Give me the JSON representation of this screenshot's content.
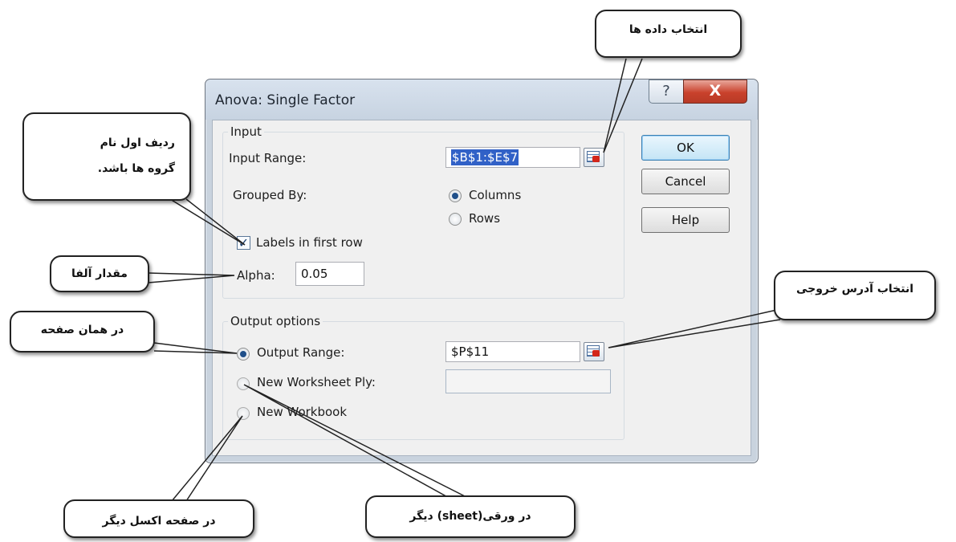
{
  "dialog": {
    "title": "Anova: Single Factor",
    "help_glyph": "?",
    "close_glyph": "X"
  },
  "input_group": {
    "title": "Input",
    "input_range_label": "Input Range:",
    "input_range_value": "$B$1:$E$7",
    "grouped_by_label": "Grouped By:",
    "columns_label": "Columns",
    "rows_label": "Rows",
    "grouped_by_selected": "Columns",
    "labels_checkbox_label": "Labels in first row",
    "labels_checked": true,
    "alpha_label": "Alpha:",
    "alpha_value": "0.05"
  },
  "buttons": {
    "ok": "OK",
    "cancel": "Cancel",
    "help": "Help"
  },
  "output_group": {
    "title": "Output options",
    "output_range_label": "Output Range:",
    "output_range_value": "$P$11",
    "new_worksheet_label": "New Worksheet Ply:",
    "new_worksheet_value": "",
    "new_workbook_label": "New Workbook",
    "selected": "Output Range"
  },
  "callouts": {
    "select_data": "انتخاب داده ها",
    "first_row_names_line1": "ردیف اول نام",
    "first_row_names_line2": "گروه ها باشد.",
    "alpha_value": "مقدار آلفا",
    "select_output_address": "انتخاب آدرس خروجی",
    "same_sheet": "در همان صفحه",
    "other_sheet": "در ورقی(sheet) دیگر",
    "other_excel": "در صفحه اکسل دیگر"
  },
  "icons": {
    "refedit": "range-selector-icon",
    "help": "question-icon",
    "close": "close-icon"
  },
  "colors": {
    "selection": "#3161c7",
    "close_button": "#c9412c",
    "dialog_frame": "#c9d3de"
  }
}
